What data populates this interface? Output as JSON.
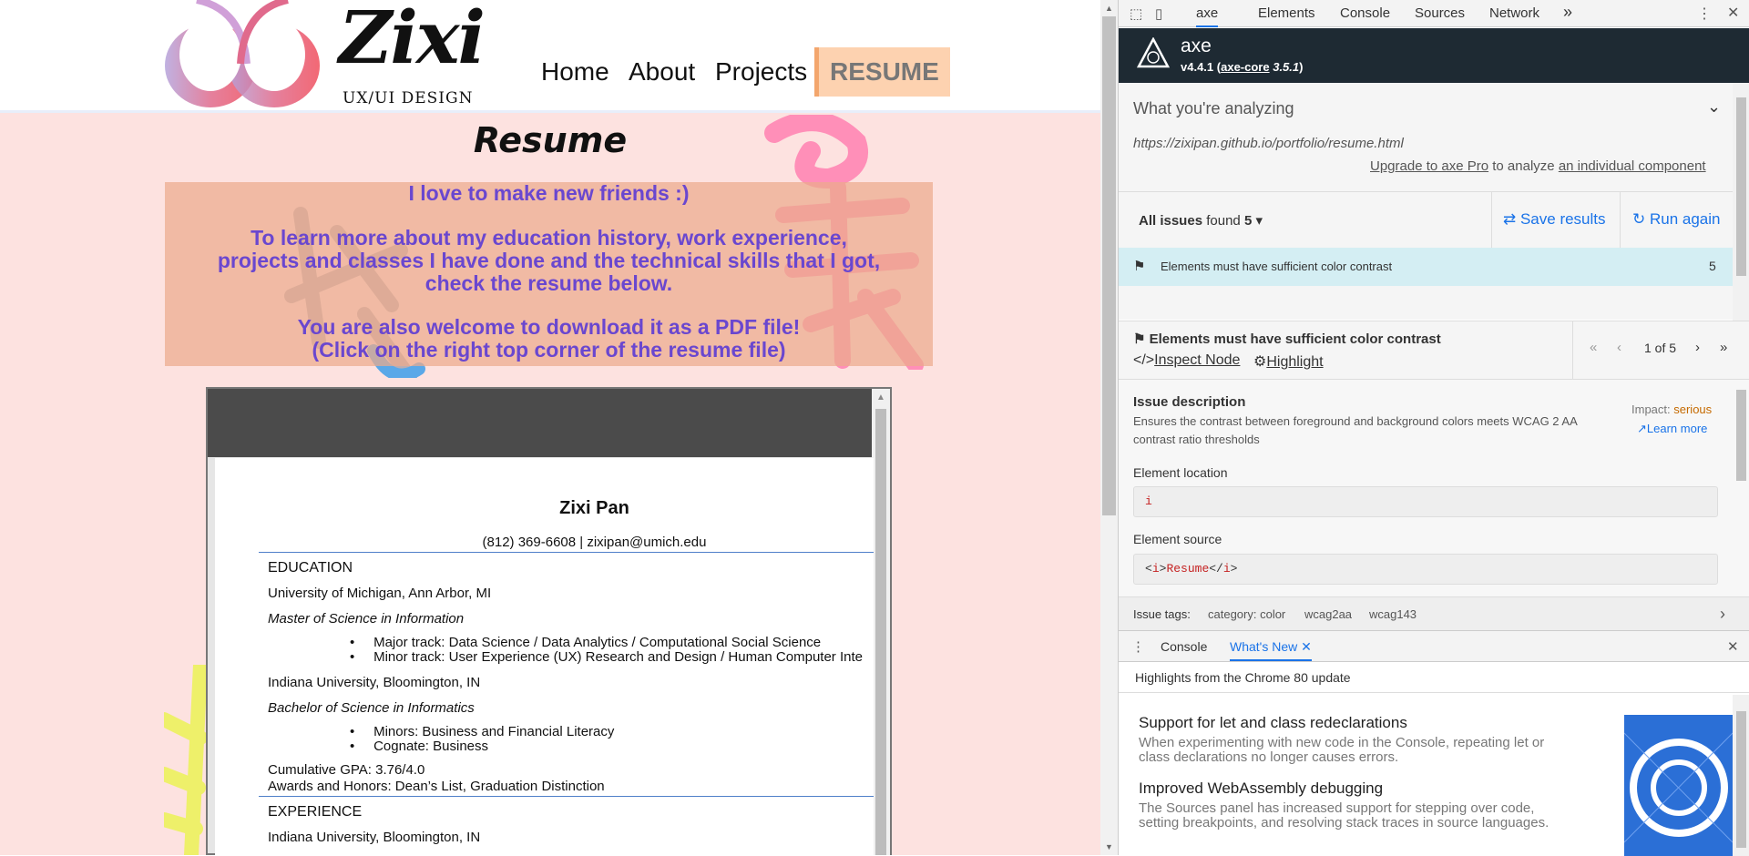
{
  "site": {
    "logo_text": "Zixi",
    "logo_subtitle": "UX/UI DESIGN",
    "nav": {
      "home": "Home",
      "about": "About",
      "projects": "Projects",
      "resume": "RESUME"
    },
    "title": "Resume",
    "intro": {
      "line1": "I love to make new friends :)",
      "line2": "To learn more about my education history, work experience, projects and classes I have done and the technical skills that I got, check the resume below.",
      "line3": "You are also welcome to download it as a PDF file!",
      "line4": "(Click on the right top corner of the resume file)"
    }
  },
  "resume": {
    "name": "Zixi Pan",
    "contact": "(812) 369-6608 | zixipan@umich.edu",
    "education_heading": "EDUCATION",
    "school1": "University of Michigan, Ann Arbor, MI",
    "degree1": "Master of Science in Information",
    "degree1_bullets": [
      "Major track: Data Science / Data Analytics / Computational Social Science",
      "Minor track: User Experience (UX) Research and Design / Human Computer Inte"
    ],
    "school2": "Indiana University, Bloomington, IN",
    "degree2": "Bachelor of Science in Informatics",
    "degree2_bullets": [
      "Minors: Business and Financial Literacy",
      "Cognate: Business"
    ],
    "gpa": "Cumulative GPA: 3.76/4.0",
    "awards": "Awards and Honors: Dean’s List, Graduation Distinction",
    "experience_heading": "EXPERIENCE",
    "exp_school": "Indiana University, Bloomington, IN"
  },
  "devtools": {
    "tabs": {
      "axe": "axe",
      "elements": "Elements",
      "console": "Console",
      "sources": "Sources",
      "network": "Network",
      "more": "»"
    },
    "axe": {
      "name": "axe",
      "version": "v4.4.1",
      "core_link": "axe-core",
      "core_version": "3.5.1",
      "analyzing_label": "What you're analyzing",
      "url": "https://zixipan.github.io/portfolio/resume.html",
      "upgrade_link": "Upgrade to axe Pro",
      "upgrade_mid": "to analyze",
      "component_link": "an individual component",
      "issues_prefix": "All issues",
      "issues_found": "found",
      "issues_count": "5",
      "save_results": "Save results",
      "run_again": "Run again",
      "issue_title": "Elements must have sufficient color contrast",
      "issue_count": "5",
      "detail_title": "Elements must have sufficient color contrast",
      "inspect_node": "Inspect Node",
      "highlight": "Highlight",
      "pager": "1 of 5",
      "issue_desc_label": "Issue description",
      "issue_desc": "Ensures the contrast between foreground and background colors meets WCAG 2 AA contrast ratio thresholds",
      "impact_label": "Impact:",
      "impact_value": "serious",
      "learn_more": "Learn more",
      "element_location_label": "Element location",
      "element_location": "i",
      "element_source_label": "Element source",
      "element_source_open": "<",
      "element_source_tag": "i",
      "element_source_gt": ">",
      "element_source_text": "Resume",
      "element_source_close": "</",
      "tags_label": "Issue tags:",
      "tags": [
        "category: color",
        "wcag2aa",
        "wcag143"
      ]
    },
    "drawer": {
      "tab_console": "Console",
      "tab_whatsnew": "What's New",
      "headline": "Highlights from the Chrome 80 update",
      "items": [
        {
          "title": "Support for let and class redeclarations",
          "desc": "When experimenting with new code in the Console, repeating let or class declarations no longer causes errors."
        },
        {
          "title": "Improved WebAssembly debugging",
          "desc": "The Sources panel has increased support for stepping over code, setting breakpoints, and resolving stack traces in source languages."
        }
      ]
    }
  },
  "colors": {
    "intro_text": "#6a47cf",
    "resume_nav_bg": "#fdd2b0",
    "axe_header": "#1e2a33",
    "impact_serious": "#c56a00",
    "link_blue": "#1a73e8"
  }
}
